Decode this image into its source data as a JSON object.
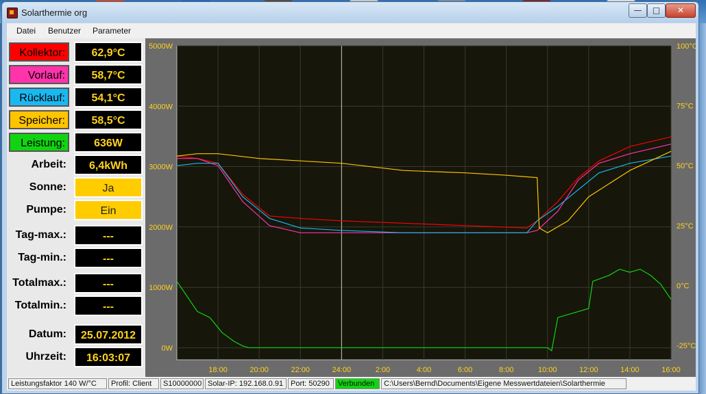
{
  "window": {
    "title": "Solarthermie org"
  },
  "menu": [
    "Datei",
    "Benutzer",
    "Parameter"
  ],
  "readings": [
    {
      "label": "Kollektor:",
      "value": "62,9°C",
      "color": "#ff0000"
    },
    {
      "label": "Vorlauf:",
      "value": "58,7°C",
      "color": "#ff33aa"
    },
    {
      "label": "Rücklauf:",
      "value": "54,1°C",
      "color": "#1ab8f0"
    },
    {
      "label": "Speicher:",
      "value": "58,5°C",
      "color": "#ffc400"
    },
    {
      "label": "Leistung:",
      "value": "636W",
      "color": "#11d411"
    },
    {
      "label": "Arbeit:",
      "value": "6,4kWh"
    },
    {
      "label": "Sonne:",
      "value": "Ja"
    },
    {
      "label": "Pumpe:",
      "value": "Ein"
    },
    {
      "label": "Tag-max.:",
      "value": "---"
    },
    {
      "label": "Tag-min.:",
      "value": "---"
    },
    {
      "label": "Totalmax.:",
      "value": "---"
    },
    {
      "label": "Totalmin.:",
      "value": "---"
    },
    {
      "label": "Datum:",
      "value": "25.07.2012"
    },
    {
      "label": "Uhrzeit:",
      "value": "16:03:07"
    }
  ],
  "chart_data": {
    "type": "line",
    "x_ticks": [
      "18:00",
      "20:00",
      "22:00",
      "24:00",
      "2:00",
      "4:00",
      "6:00",
      "8:00",
      "10:00",
      "12:00",
      "14:00",
      "16:00"
    ],
    "y_left_ticks": [
      "5000W",
      "4000W",
      "3000W",
      "2000W",
      "1000W",
      "0W"
    ],
    "y_right_ticks": [
      "100°C",
      "75°C",
      "50°C",
      "25°C",
      "0°C",
      "-25°C"
    ],
    "x_range_hours": [
      16.0,
      40.0
    ],
    "cursor_x_hour": 24.0,
    "grid": true,
    "series": [
      {
        "color": "#ff0000",
        "unit": "°C",
        "x": [
          16.0,
          17.0,
          18.0,
          19.2,
          20.5,
          22.0,
          24.0,
          27.0,
          30.0,
          33.0,
          33.5,
          34.5,
          35.5,
          36.5,
          38.0,
          40.0
        ],
        "y": [
          54,
          53,
          51,
          38,
          29,
          28,
          27,
          26,
          25,
          24,
          27,
          35,
          45,
          52,
          58,
          62
        ]
      },
      {
        "color": "#ff33aa",
        "unit": "°C",
        "x": [
          16.0,
          17.0,
          18.0,
          19.2,
          20.5,
          22.0,
          24.0,
          27.0,
          30.0,
          33.0,
          33.5,
          34.5,
          35.5,
          36.5,
          38.0,
          40.0
        ],
        "y": [
          53,
          53,
          50,
          35,
          25,
          22,
          22,
          22,
          22,
          22,
          23,
          31,
          44,
          51,
          55,
          59
        ]
      },
      {
        "color": "#1ab8f0",
        "unit": "°C",
        "x": [
          16.0,
          17.0,
          18.0,
          19.2,
          20.5,
          22.0,
          24.0,
          27.0,
          30.0,
          33.0,
          33.5,
          34.5,
          35.5,
          36.5,
          38.0,
          40.0
        ],
        "y": [
          50,
          51,
          51,
          37,
          28,
          24,
          23,
          22,
          22,
          22,
          27,
          33,
          40,
          47,
          51,
          54
        ]
      },
      {
        "color": "#ffc400",
        "unit": "°C",
        "x": [
          16.0,
          17.0,
          18.0,
          20.0,
          22.0,
          24.0,
          27.0,
          30.0,
          32.0,
          33.5,
          33.6,
          34.0,
          35.0,
          36.0,
          38.0,
          40.0
        ],
        "y": [
          54,
          55,
          55,
          53,
          52,
          51,
          48,
          47,
          46,
          45,
          24,
          22,
          27,
          37,
          48,
          56
        ]
      },
      {
        "color": "#11d411",
        "unit": "W",
        "x": [
          16.0,
          16.4,
          17.0,
          17.6,
          18.2,
          18.8,
          19.2,
          19.5,
          20.0,
          24.0,
          30.0,
          34.0,
          34.2,
          34.5,
          35.0,
          35.5,
          36.0,
          36.2,
          37.0,
          37.5,
          38.0,
          38.5,
          39.0,
          39.5,
          40.0
        ],
        "y": [
          1100,
          900,
          600,
          500,
          250,
          100,
          30,
          0,
          0,
          0,
          0,
          0,
          -50,
          500,
          550,
          600,
          650,
          1100,
          1200,
          1300,
          1250,
          1300,
          1200,
          1050,
          800
        ]
      }
    ],
    "w_range": [
      -200,
      5000
    ],
    "c_range": [
      -31,
      100
    ]
  },
  "status": [
    "Leistungsfaktor 140 W/°C",
    "Profil: Client",
    "S10000000",
    "Solar-IP: 192.168.0.91",
    "Port: 50290",
    "Verbunden",
    "C:\\Users\\Bernd\\Documents\\Eigene Messwertdateien\\Solarthermie"
  ]
}
